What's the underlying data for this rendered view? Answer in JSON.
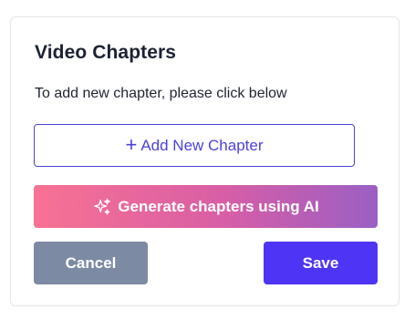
{
  "panel": {
    "title": "Video Chapters",
    "subtitle": "To add new chapter, please click below"
  },
  "buttons": {
    "add_icon": "+",
    "add_label": "Add New Chapter",
    "ai_icon": "sparkles-icon",
    "ai_label": "Generate chapters using AI",
    "cancel_label": "Cancel",
    "save_label": "Save"
  },
  "colors": {
    "accent": "#4a42d6",
    "save": "#4e34f5",
    "cancel": "#7d8aa3",
    "ai_gradient_start": "#f87293",
    "ai_gradient_end": "#9a5fc4"
  }
}
